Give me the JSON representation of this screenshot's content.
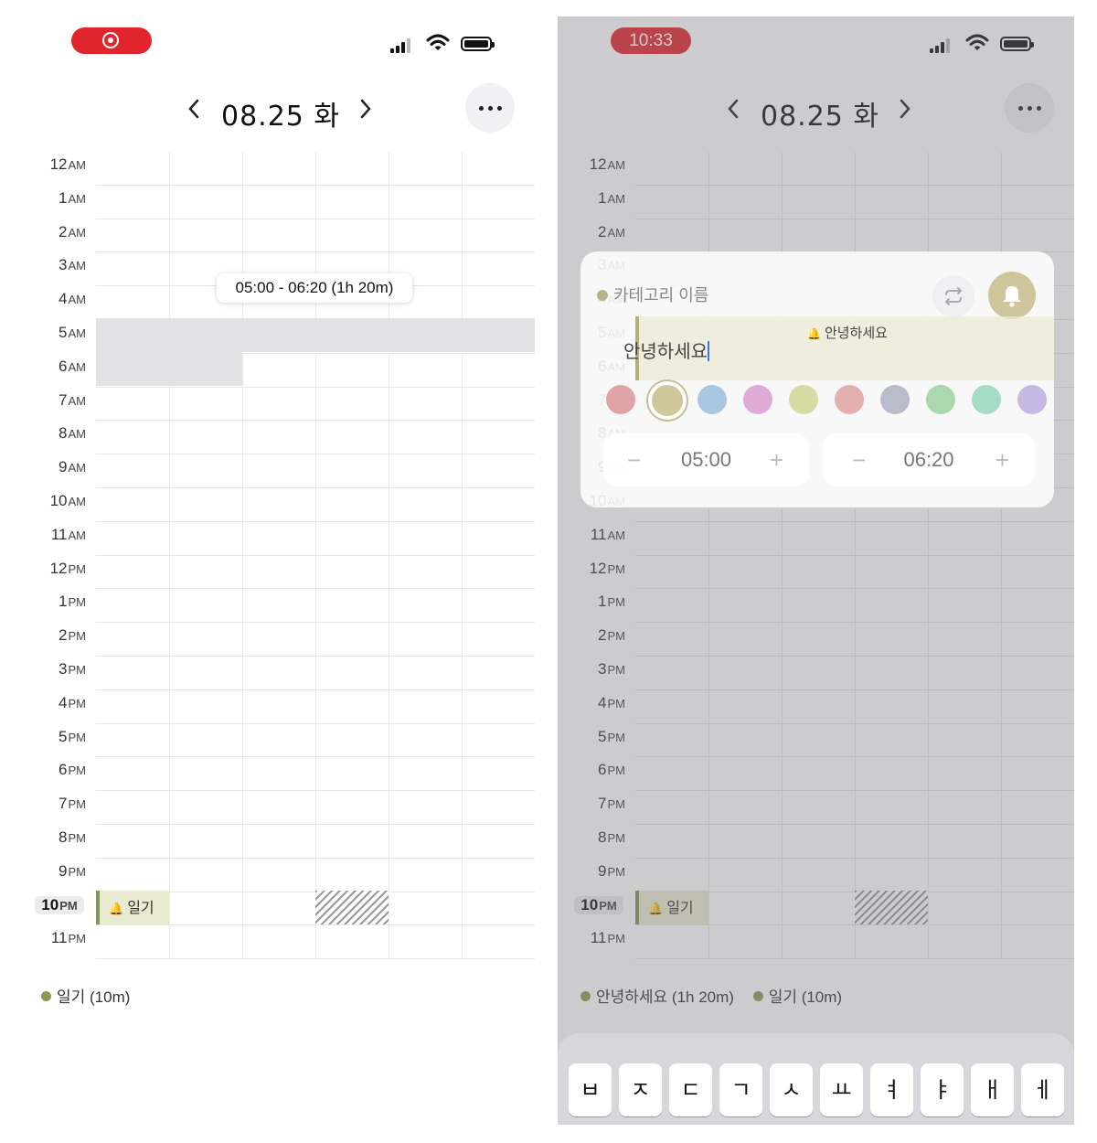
{
  "left": {
    "status": {
      "recording": true
    },
    "header": {
      "date": "08.25 화"
    },
    "time_bubble": "05:00 - 06:20 (1h 20m)",
    "event_label": "일기",
    "summary": [
      {
        "label": "일기 (10m)",
        "color": "#8a9a4f"
      }
    ]
  },
  "right": {
    "status": {
      "time": "10:33"
    },
    "header": {
      "date": "08.25 화"
    },
    "sheet": {
      "category_placeholder": "카테고리 이름",
      "title_value": "안녕하세요",
      "preview_label": "안녕하세요",
      "start_time": "05:00",
      "end_time": "06:20",
      "minus": "−",
      "plus": "+",
      "colors": [
        "#e0a3a6",
        "#cfc69c",
        "#a9c7e0",
        "#dfaad6",
        "#d7dca4",
        "#e4b0ae",
        "#b9bccb",
        "#a9d9ad",
        "#a5dcc6",
        "#c7b8e5"
      ],
      "selected_color": "#cfc69c"
    },
    "event_label": "일기",
    "summary": [
      {
        "label": "안녕하세요 (1h 20m)",
        "color": "#8a9a4f"
      },
      {
        "label": "일기 (10m)",
        "color": "#8a9a4f"
      }
    ],
    "keyboard_keys": [
      "ㅂ",
      "ㅈ",
      "ㄷ",
      "ㄱ",
      "ㅅ",
      "ㅛ",
      "ㅕ",
      "ㅑ",
      "ㅐ",
      "ㅔ"
    ]
  },
  "hours": [
    {
      "h": "12",
      "p": "AM"
    },
    {
      "h": "1",
      "p": "AM"
    },
    {
      "h": "2",
      "p": "AM"
    },
    {
      "h": "3",
      "p": "AM"
    },
    {
      "h": "4",
      "p": "AM"
    },
    {
      "h": "5",
      "p": "AM"
    },
    {
      "h": "6",
      "p": "AM"
    },
    {
      "h": "7",
      "p": "AM"
    },
    {
      "h": "8",
      "p": "AM"
    },
    {
      "h": "9",
      "p": "AM"
    },
    {
      "h": "10",
      "p": "AM"
    },
    {
      "h": "11",
      "p": "AM"
    },
    {
      "h": "12",
      "p": "PM"
    },
    {
      "h": "1",
      "p": "PM"
    },
    {
      "h": "2",
      "p": "PM"
    },
    {
      "h": "3",
      "p": "PM"
    },
    {
      "h": "4",
      "p": "PM"
    },
    {
      "h": "5",
      "p": "PM"
    },
    {
      "h": "6",
      "p": "PM"
    },
    {
      "h": "7",
      "p": "PM"
    },
    {
      "h": "8",
      "p": "PM"
    },
    {
      "h": "9",
      "p": "PM"
    },
    {
      "h": "10",
      "p": "PM"
    },
    {
      "h": "11",
      "p": "PM"
    }
  ],
  "current_hour": "10 PM"
}
